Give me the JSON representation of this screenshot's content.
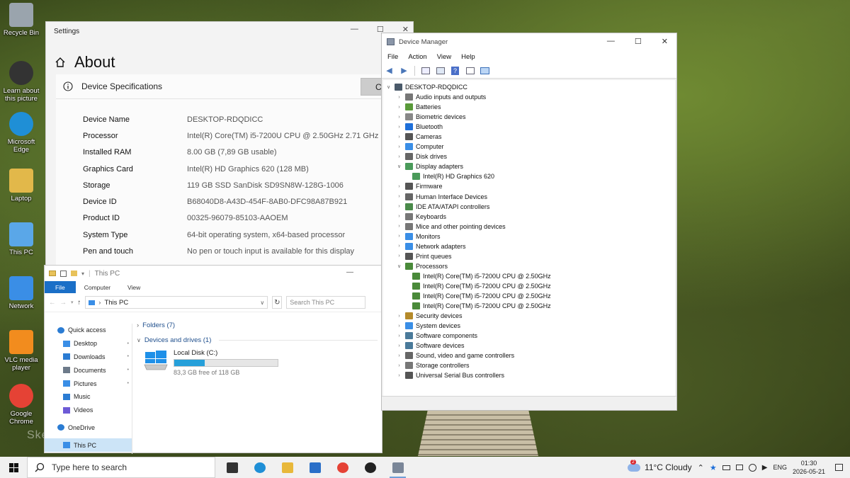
{
  "desktop": {
    "icons": [
      {
        "label": "Recycle Bin",
        "icon": "recycle-bin-icon"
      },
      {
        "label": "Learn about this picture",
        "icon": "learn-about-icon"
      },
      {
        "label": "Microsoft Edge",
        "icon": "edge-icon"
      },
      {
        "label": "Laptop",
        "icon": "folder-user-icon"
      },
      {
        "label": "This PC",
        "icon": "this-pc-icon"
      },
      {
        "label": "Network",
        "icon": "network-icon"
      },
      {
        "label": "VLC media player",
        "icon": "vlc-icon"
      },
      {
        "label": "Google Chrome",
        "icon": "chrome-icon"
      }
    ],
    "watermark": "Skelbiu.lt"
  },
  "settings": {
    "window_title": "Settings",
    "page_title": "About",
    "section_title": "Device Specifications",
    "copy_label": "Copy",
    "specs": [
      {
        "key": "Device Name",
        "value": "DESKTOP-RDQDICC"
      },
      {
        "key": "Processor",
        "value": "Intel(R) Core(TM) i5-7200U CPU @ 2.50GHz   2.71 GHz"
      },
      {
        "key": "Installed RAM",
        "value": "8.00 GB (7,89 GB usable)"
      },
      {
        "key": "Graphics Card",
        "value": "Intel(R) HD Graphics 620 (128 MB)"
      },
      {
        "key": "Storage",
        "value": "119 GB SSD SanDisk SD9SN8W-128G-1006"
      },
      {
        "key": "Device ID",
        "value": "B68040D8-A43D-454F-8AB0-DFC98A87B921"
      },
      {
        "key": "Product ID",
        "value": "00325-96079-85103-AAOEM"
      },
      {
        "key": "System Type",
        "value": "64-bit operating system, x64-based processor"
      },
      {
        "key": "Pen and touch",
        "value": "No pen or touch input is available for this display"
      }
    ]
  },
  "explorer": {
    "window_title": "This PC",
    "tabs": [
      "File",
      "Computer",
      "View"
    ],
    "address": "This PC",
    "search_placeholder": "Search This PC",
    "nav": [
      {
        "label": "Quick access",
        "top": true,
        "color": "#2b7cd3",
        "icon": "star-icon"
      },
      {
        "label": "Desktop",
        "pinned": true,
        "color": "#3a8ee6",
        "icon": "desktop-folder-icon"
      },
      {
        "label": "Downloads",
        "pinned": true,
        "color": "#2b7cd3",
        "icon": "download-icon"
      },
      {
        "label": "Documents",
        "pinned": true,
        "color": "#6d7a8a",
        "icon": "documents-icon"
      },
      {
        "label": "Pictures",
        "pinned": true,
        "color": "#3a8ee6",
        "icon": "pictures-icon"
      },
      {
        "label": "Music",
        "color": "#2b7cd3",
        "icon": "music-icon"
      },
      {
        "label": "Videos",
        "color": "#6d5ad6",
        "icon": "videos-icon"
      },
      {
        "label": "",
        "spacer": true
      },
      {
        "label": "OneDrive",
        "top": true,
        "color": "#2b7cd3",
        "icon": "onedrive-icon"
      },
      {
        "label": "",
        "spacer": true
      },
      {
        "label": "This PC",
        "selected": true,
        "color": "#3a8ee6",
        "icon": "this-pc-icon"
      }
    ],
    "folders_group": "Folders (7)",
    "drives_group": "Devices and drives (1)",
    "drive": {
      "name": "Local Disk (C:)",
      "free_text": "83,3 GB free of 118 GB",
      "used_fraction": 0.294
    }
  },
  "device_manager": {
    "window_title": "Device Manager",
    "menu": [
      "File",
      "Action",
      "View",
      "Help"
    ],
    "root": "DESKTOP-RDQDICC",
    "tree": [
      {
        "label": "Audio inputs and outputs",
        "color": "#777"
      },
      {
        "label": "Batteries",
        "color": "#5a9a3a"
      },
      {
        "label": "Biometric devices",
        "color": "#888"
      },
      {
        "label": "Bluetooth",
        "color": "#1e6fd9"
      },
      {
        "label": "Cameras",
        "color": "#555"
      },
      {
        "label": "Computer",
        "color": "#3a8ee6"
      },
      {
        "label": "Disk drives",
        "color": "#666"
      },
      {
        "label": "Display adapters",
        "color": "#4a9a5a",
        "expanded": true
      },
      {
        "label": "Intel(R) HD Graphics 620",
        "color": "#4a9a5a",
        "child": true
      },
      {
        "label": "Firmware",
        "color": "#555"
      },
      {
        "label": "Human Interface Devices",
        "color": "#666"
      },
      {
        "label": "IDE ATA/ATAPI controllers",
        "color": "#4a8a4a"
      },
      {
        "label": "Keyboards",
        "color": "#777"
      },
      {
        "label": "Mice and other pointing devices",
        "color": "#777"
      },
      {
        "label": "Monitors",
        "color": "#3a8ee6"
      },
      {
        "label": "Network adapters",
        "color": "#3a8ee6"
      },
      {
        "label": "Print queues",
        "color": "#555"
      },
      {
        "label": "Processors",
        "color": "#4a8a3a",
        "expanded": true
      },
      {
        "label": "Intel(R) Core(TM) i5-7200U CPU @ 2.50GHz",
        "color": "#4a8a3a",
        "child": true
      },
      {
        "label": "Intel(R) Core(TM) i5-7200U CPU @ 2.50GHz",
        "color": "#4a8a3a",
        "child": true
      },
      {
        "label": "Intel(R) Core(TM) i5-7200U CPU @ 2.50GHz",
        "color": "#4a8a3a",
        "child": true
      },
      {
        "label": "Intel(R) Core(TM) i5-7200U CPU @ 2.50GHz",
        "color": "#4a8a3a",
        "child": true
      },
      {
        "label": "Security devices",
        "color": "#b58a2a"
      },
      {
        "label": "System devices",
        "color": "#3a8ee6"
      },
      {
        "label": "Software components",
        "color": "#4a7a9a"
      },
      {
        "label": "Software devices",
        "color": "#4a7a9a"
      },
      {
        "label": "Sound, video and game controllers",
        "color": "#666"
      },
      {
        "label": "Storage controllers",
        "color": "#777"
      },
      {
        "label": "Universal Serial Bus controllers",
        "color": "#555"
      }
    ]
  },
  "taskbar": {
    "search_placeholder": "Type here to search",
    "weather": "11°C  Cloudy",
    "weather_badge": "2",
    "lang": "ENG",
    "time": "01:30",
    "date": "2026-05-21",
    "apps": [
      "task-view-icon",
      "edge-icon",
      "file-explorer-icon",
      "outlook-icon",
      "chrome-icon",
      "settings-gear-icon",
      "device-manager-icon"
    ]
  }
}
